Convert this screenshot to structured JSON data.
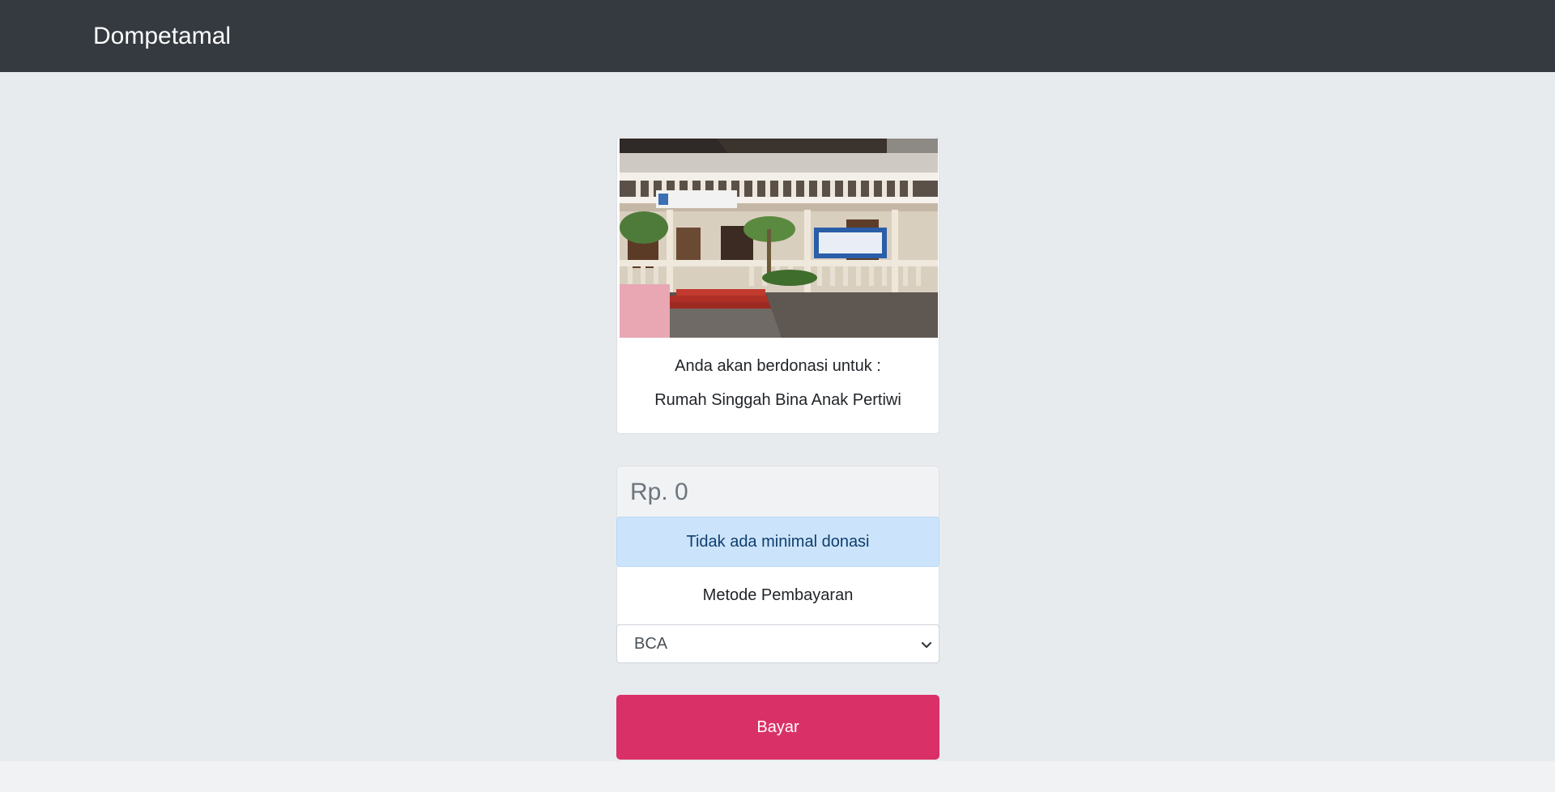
{
  "navbar": {
    "brand": "Dompetamal"
  },
  "donation_card": {
    "photo_name": "shelter-building-photo",
    "intro_text": "Anda akan berdonasi untuk :",
    "recipient": "Rumah Singgah Bina Anak Pertiwi"
  },
  "amount": {
    "placeholder": "Rp. 0",
    "value": ""
  },
  "notice": {
    "text": "Tidak ada minimal donasi"
  },
  "payment": {
    "label": "Metode Pembayaran",
    "selected": "BCA",
    "chevron_icon": "chevron-down-icon"
  },
  "submit": {
    "label": "Bayar"
  },
  "colors": {
    "navbar": "#343a40",
    "background": "#e8ebee",
    "notice_bg": "#cce4fb",
    "notice_text": "#0f3e6e",
    "pay_button": "#da3068"
  }
}
